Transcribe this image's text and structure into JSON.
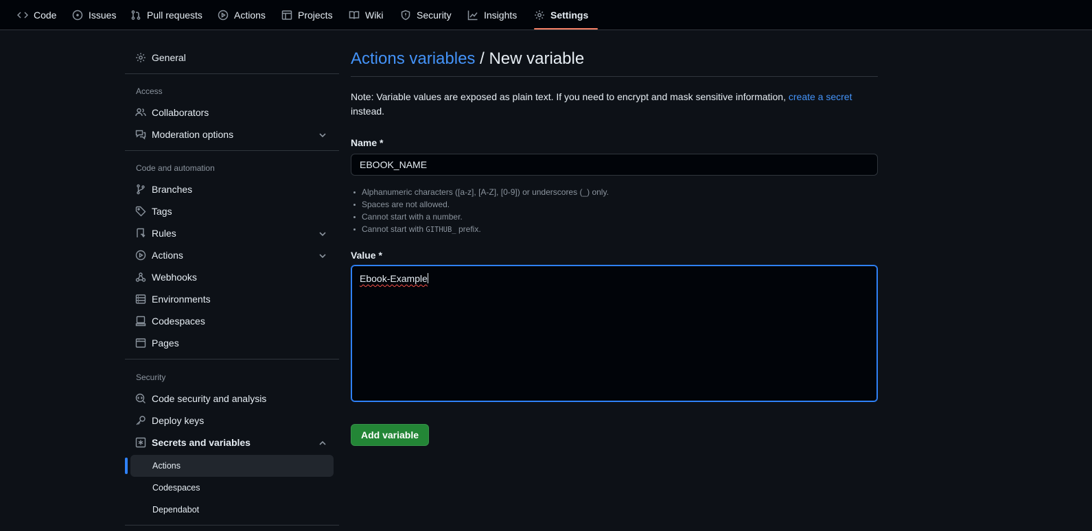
{
  "nav": {
    "tabs": [
      {
        "label": "Code",
        "icon": "code-icon"
      },
      {
        "label": "Issues",
        "icon": "issues-icon"
      },
      {
        "label": "Pull requests",
        "icon": "pull-request-icon"
      },
      {
        "label": "Actions",
        "icon": "play-icon"
      },
      {
        "label": "Projects",
        "icon": "table-icon"
      },
      {
        "label": "Wiki",
        "icon": "book-icon"
      },
      {
        "label": "Security",
        "icon": "shield-icon"
      },
      {
        "label": "Insights",
        "icon": "graph-icon"
      },
      {
        "label": "Settings",
        "icon": "gear-icon",
        "active": true
      }
    ]
  },
  "sidebar": {
    "general": "General",
    "access_heading": "Access",
    "collaborators": "Collaborators",
    "moderation": "Moderation options",
    "automation_heading": "Code and automation",
    "branches": "Branches",
    "tags": "Tags",
    "rules": "Rules",
    "actions": "Actions",
    "webhooks": "Webhooks",
    "environments": "Environments",
    "codespaces": "Codespaces",
    "pages": "Pages",
    "security_heading": "Security",
    "code_security": "Code security and analysis",
    "deploy_keys": "Deploy keys",
    "secrets": "Secrets and variables",
    "sub_actions": "Actions",
    "sub_codespaces": "Codespaces",
    "sub_dependabot": "Dependabot"
  },
  "main": {
    "breadcrumb_link": "Actions variables",
    "breadcrumb_sep": " / ",
    "title": "New variable",
    "note_text": "Note: Variable values are exposed as plain text. If you need to encrypt and mask sensitive information, ",
    "note_link": "create a secret",
    "note_end": "instead.",
    "name_label": "Name *",
    "name_value": "EBOOK_NAME",
    "hints": [
      "Alphanumeric characters ([a-z], [A-Z], [0-9]) or underscores (_) only.",
      "Spaces are not allowed.",
      "Cannot start with a number."
    ],
    "hint_prefix_pre": "Cannot start with ",
    "hint_prefix_code": "GITHUB_",
    "hint_prefix_post": " prefix.",
    "value_label": "Value *",
    "value_text": "Ebook-Example",
    "submit": "Add variable"
  },
  "colors": {
    "accent_link": "#4493f8",
    "active_tab_underline": "#f78166",
    "primary_button": "#238636",
    "focus_border": "#2f81f7"
  }
}
